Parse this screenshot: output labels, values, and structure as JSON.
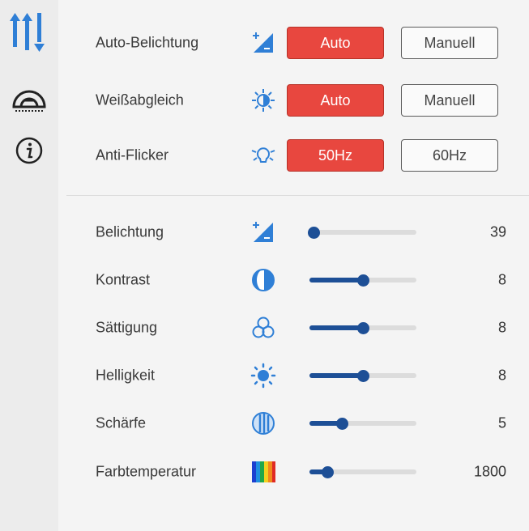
{
  "sidebar": {
    "items": [
      {
        "icon": "sliders-icon",
        "active": true
      },
      {
        "icon": "gauge-icon",
        "active": false
      },
      {
        "icon": "info-icon",
        "active": false
      }
    ]
  },
  "modes": [
    {
      "label": "Auto-Belichtung",
      "icon": "exposure-icon",
      "selected": "Auto",
      "other": "Manuell"
    },
    {
      "label": "Weißabgleich",
      "icon": "white-balance-icon",
      "selected": "Auto",
      "other": "Manuell"
    },
    {
      "label": "Anti-Flicker",
      "icon": "flicker-icon",
      "selected": "50Hz",
      "other": "60Hz"
    }
  ],
  "sliders": [
    {
      "label": "Belichtung",
      "icon": "exposure-icon",
      "value": "39",
      "fraction": 0.04
    },
    {
      "label": "Kontrast",
      "icon": "contrast-icon",
      "value": "8",
      "fraction": 0.5
    },
    {
      "label": "Sättigung",
      "icon": "saturation-icon",
      "value": "8",
      "fraction": 0.5
    },
    {
      "label": "Helligkeit",
      "icon": "brightness-icon",
      "value": "8",
      "fraction": 0.5
    },
    {
      "label": "Schärfe",
      "icon": "sharpness-icon",
      "value": "5",
      "fraction": 0.31
    },
    {
      "label": "Farbtemperatur",
      "icon": "color-temperature-icon",
      "value": "1800",
      "fraction": 0.17
    }
  ],
  "colors": {
    "accent": "#e8473f",
    "slider": "#1d4f96",
    "icon": "#2f7fd6"
  }
}
